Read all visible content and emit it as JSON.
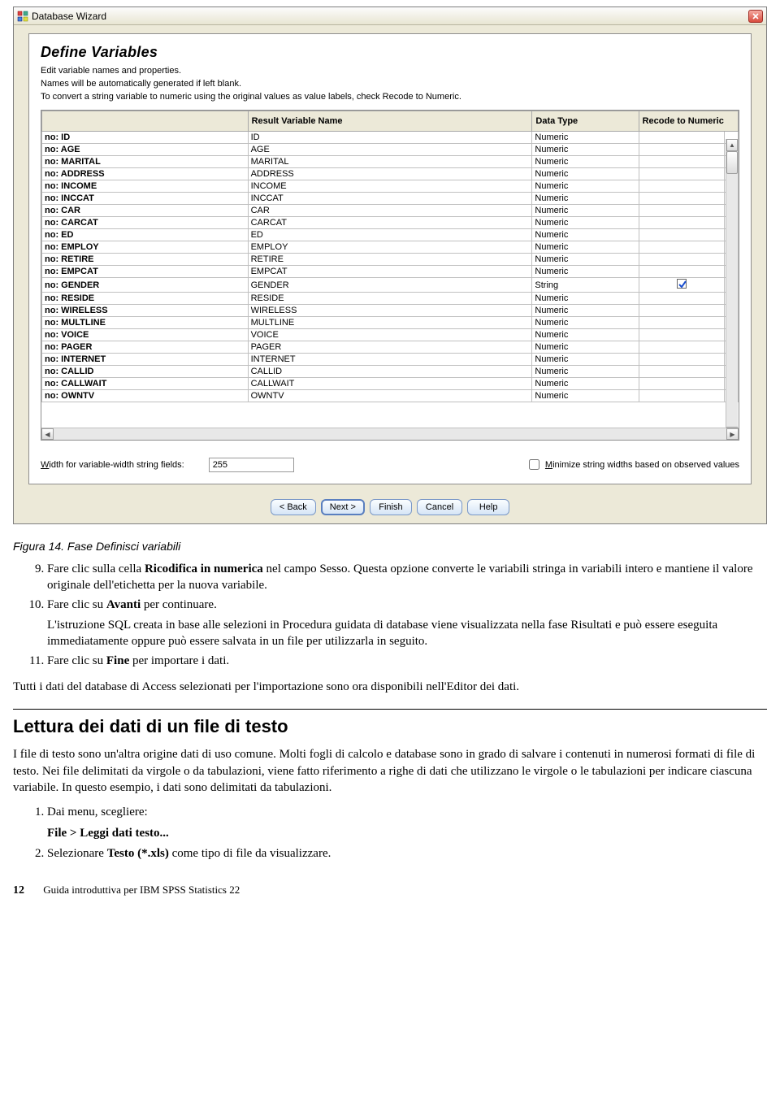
{
  "dialog": {
    "window_title": "Database Wizard",
    "heading": "Define Variables",
    "intro1": "Edit variable names and properties.",
    "intro2": "Names will be automatically generated if left blank.",
    "intro3": "To convert a string variable to numeric using the original values as value labels, check Recode to Numeric.",
    "columns": {
      "c1": "",
      "c2": "Result Variable Name",
      "c3": "Data Type",
      "c4": "Recode to Numeric"
    },
    "rows": [
      {
        "src": "no: ID",
        "name": "ID",
        "type": "Numeric",
        "recode": false
      },
      {
        "src": "no: AGE",
        "name": "AGE",
        "type": "Numeric",
        "recode": false
      },
      {
        "src": "no: MARITAL",
        "name": "MARITAL",
        "type": "Numeric",
        "recode": false
      },
      {
        "src": "no: ADDRESS",
        "name": "ADDRESS",
        "type": "Numeric",
        "recode": false
      },
      {
        "src": "no: INCOME",
        "name": "INCOME",
        "type": "Numeric",
        "recode": false
      },
      {
        "src": "no: INCCAT",
        "name": "INCCAT",
        "type": "Numeric",
        "recode": false
      },
      {
        "src": "no: CAR",
        "name": "CAR",
        "type": "Numeric",
        "recode": false
      },
      {
        "src": "no: CARCAT",
        "name": "CARCAT",
        "type": "Numeric",
        "recode": false
      },
      {
        "src": "no: ED",
        "name": "ED",
        "type": "Numeric",
        "recode": false
      },
      {
        "src": "no: EMPLOY",
        "name": "EMPLOY",
        "type": "Numeric",
        "recode": false
      },
      {
        "src": "no: RETIRE",
        "name": "RETIRE",
        "type": "Numeric",
        "recode": false
      },
      {
        "src": "no: EMPCAT",
        "name": "EMPCAT",
        "type": "Numeric",
        "recode": false
      },
      {
        "src": "no: GENDER",
        "name": "GENDER",
        "type": "String",
        "recode": true
      },
      {
        "src": "no: RESIDE",
        "name": "RESIDE",
        "type": "Numeric",
        "recode": false
      },
      {
        "src": "no: WIRELESS",
        "name": "WIRELESS",
        "type": "Numeric",
        "recode": false
      },
      {
        "src": "no: MULTLINE",
        "name": "MULTLINE",
        "type": "Numeric",
        "recode": false
      },
      {
        "src": "no: VOICE",
        "name": "VOICE",
        "type": "Numeric",
        "recode": false
      },
      {
        "src": "no: PAGER",
        "name": "PAGER",
        "type": "Numeric",
        "recode": false
      },
      {
        "src": "no: INTERNET",
        "name": "INTERNET",
        "type": "Numeric",
        "recode": false
      },
      {
        "src": "no: CALLID",
        "name": "CALLID",
        "type": "Numeric",
        "recode": false
      },
      {
        "src": "no: CALLWAIT",
        "name": "CALLWAIT",
        "type": "Numeric",
        "recode": false
      },
      {
        "src": "no: OWNTV",
        "name": "OWNTV",
        "type": "Numeric",
        "recode": false
      }
    ],
    "width_label_pre": "W",
    "width_label": "idth for variable-width string fields:",
    "width_value": "255",
    "minimize_pre": "M",
    "minimize_label": "inimize string widths based on observed values",
    "buttons": {
      "back": "< Back",
      "next": "Next >",
      "finish": "Finish",
      "cancel": "Cancel",
      "help": "Help"
    }
  },
  "doc": {
    "caption": "Figura 14. Fase Definisci variabili",
    "step9_pre": "Fare clic sulla cella ",
    "step9_bold": "Ricodifica in numerica",
    "step9_post": " nel campo Sesso. Questa opzione converte le variabili stringa in variabili intero e mantiene il valore originale dell'etichetta per la nuova variabile.",
    "step10_pre": "Fare clic su ",
    "step10_bold": "Avanti",
    "step10_post": " per continuare.",
    "step10_para": "L'istruzione SQL creata in base alle selezioni in Procedura guidata di database viene visualizzata nella fase Risultati e può essere eseguita immediatamente oppure può essere salvata in un file per utilizzarla in seguito.",
    "step11_pre": "Fare clic su ",
    "step11_bold": "Fine",
    "step11_post": " per importare i dati.",
    "summary": "Tutti i dati del database di Access selezionati per l'importazione sono ora disponibili nell'Editor dei dati.",
    "section_title": "Lettura dei dati di un file di testo",
    "section_body": "I file di testo sono un'altra origine dati di uso comune. Molti fogli di calcolo e database sono in grado di salvare i contenuti in numerosi formati di file di testo. Nei file delimitati da virgole o da tabulazioni, viene fatto riferimento a righe di dati che utilizzano le virgole o le tabulazioni per indicare ciascuna variabile. In questo esempio, i dati sono delimitati da tabulazioni.",
    "sub1": "Dai menu, scegliere:",
    "menu_path": "File > Leggi dati testo...",
    "sub2_pre": "Selezionare ",
    "sub2_bold": "Testo (*.xls)",
    "sub2_post": " come tipo di file da visualizzare.",
    "page_number": "12",
    "footer_text": "Guida introduttiva per IBM SPSS Statistics 22"
  }
}
